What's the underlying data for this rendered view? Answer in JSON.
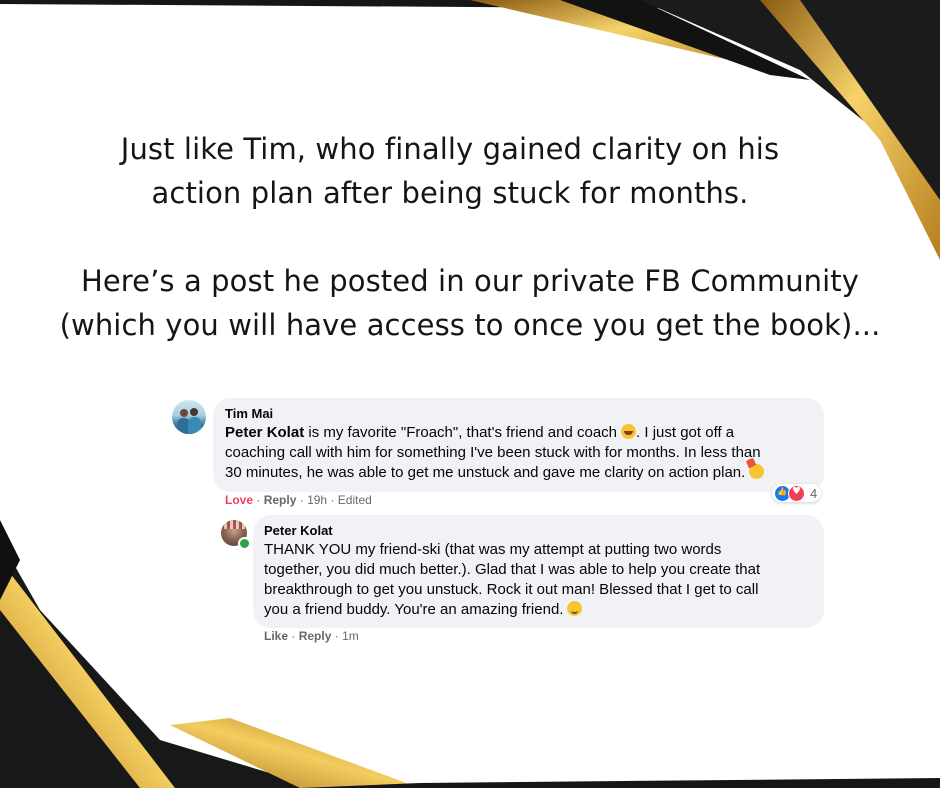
{
  "headline": {
    "line1": "Just like Tim, who finally gained clarity on his",
    "line2": "action plan after being stuck for months.",
    "line3": "Here’s a post he posted in our private FB Community",
    "line4": "(which you will have access to once you get the book)..."
  },
  "comment": {
    "author": "Tim Mai",
    "mention": "Peter Kolat",
    "line1": " is my favorite \"Froach\", that's friend and coach",
    "line1b": ". I just got off a",
    "line2": "coaching call with him for something I've been stuck with for months. In less than",
    "line3": "30 minutes, he was able to get me unstuck and gave me clarity on action plan.",
    "emoji1": "laughing-emoji",
    "emoji2": "party-face-emoji",
    "action1": "Love",
    "action2": "Reply",
    "time": "19h",
    "edited": "Edited",
    "reaction_count": "4",
    "reaction_colors": {
      "like": "#1877f2",
      "love": "#f33e58"
    }
  },
  "reply": {
    "author": "Peter Kolat",
    "line1": "THANK YOU my friend-ski (that was my attempt at putting two words",
    "line2": "together, you did much better.). Glad that I was able to help you create that",
    "line3": "breakthrough to get you unstuck. Rock it out man! Blessed that I get to call",
    "line4": "you a friend buddy. You're an amazing friend.",
    "emoji": "smiling-emoji",
    "action1": "Like",
    "action2": "Reply",
    "time": "1m"
  },
  "colors": {
    "background": "#ffffff",
    "frame_dark": "#161616",
    "frame_gold": "#e0a526",
    "bubble": "#f0f2f5",
    "love_text": "#f33e58",
    "meta_text": "#65676b"
  }
}
